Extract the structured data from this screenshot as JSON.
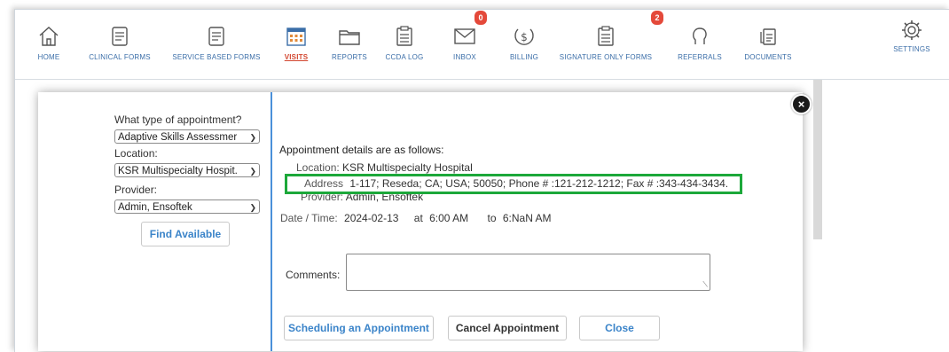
{
  "nav": {
    "items": [
      {
        "label": "HOME",
        "icon": "home-icon"
      },
      {
        "label": "CLINICAL FORMS",
        "icon": "clinical-forms-icon"
      },
      {
        "label": "SERVICE BASED FORMS",
        "icon": "service-forms-icon"
      },
      {
        "label": "VISITS",
        "icon": "calendar-icon",
        "active": true
      },
      {
        "label": "REPORTS",
        "icon": "folder-icon"
      },
      {
        "label": "CCDA LOG",
        "icon": "clipboard-icon"
      },
      {
        "label": "INBOX",
        "icon": "envelope-icon",
        "badge": "0"
      },
      {
        "label": "BILLING",
        "icon": "dollar-icon"
      },
      {
        "label": "SIGNATURE ONLY FORMS",
        "icon": "signature-forms-icon",
        "badge": "2"
      },
      {
        "label": "REFERRALS",
        "icon": "referrals-icon"
      },
      {
        "label": "DOCUMENTS",
        "icon": "documents-icon"
      },
      {
        "label": "SETTINGS",
        "icon": "gear-icon"
      }
    ],
    "accent": "#3b6ea8",
    "active_color": "#d2462f",
    "badge_color": "#e4493a"
  },
  "modal": {
    "appointment_type_label": "What type of appointment?",
    "appointment_type_value": "Adaptive Skills Assessmer",
    "location_label": "Location:",
    "location_value": "KSR Multispecialty Hospit.",
    "provider_label": "Provider:",
    "provider_value": "Admin, Ensoftek",
    "find_available": "Find Available",
    "details_title": "Appointment details are as follows:",
    "details": {
      "location_label": "Location:",
      "location_value": "KSR Multispecialty Hospital",
      "address_label": "Address",
      "address_value": "1-117; Reseda; CA; USA; 50050; Phone # :121-212-1212; Fax # :343-434-3434.",
      "provider_label": "Provider:",
      "provider_value": "Admin, Ensoftek",
      "datetime_label": "Date / Time:",
      "date_value": "2024-02-13",
      "at_label": "at",
      "start_time": "6:00 AM",
      "to_label": "to",
      "end_time": "6:NaN AM"
    },
    "comments_label": "Comments:",
    "comments_value": "",
    "buttons": {
      "schedule": "Scheduling an Appointment",
      "cancel": "Cancel Appointment",
      "close": "Close"
    },
    "highlight_color": "#1ca83a",
    "divider_color": "#4a90d9"
  }
}
